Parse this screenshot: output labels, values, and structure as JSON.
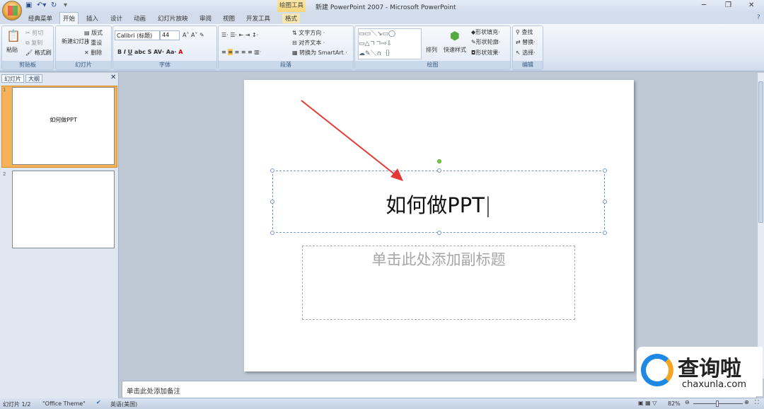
{
  "titlebar": {
    "context_tab": "绘图工具",
    "title": "新建 PowerPoint 2007 - Microsoft PowerPoint"
  },
  "tabs": [
    "经典菜单",
    "开始",
    "插入",
    "设计",
    "动画",
    "幻灯片放映",
    "审阅",
    "视图",
    "开发工具",
    "格式"
  ],
  "active_tab": "开始",
  "ribbon": {
    "clipboard": {
      "label": "剪贴板",
      "paste": "粘贴",
      "cut": "剪切",
      "copy": "复制",
      "format_painter": "格式刷"
    },
    "slides": {
      "label": "幻灯片",
      "new_slide": "新建幻灯片",
      "layout": "版式",
      "reset": "重设",
      "delete": "删除"
    },
    "font": {
      "label": "字体",
      "font_name": "Calibri (标题)",
      "font_size": "44"
    },
    "paragraph": {
      "label": "段落",
      "text_direction": "文字方向",
      "align_text": "对齐文本",
      "smartart": "转换为 SmartArt"
    },
    "drawing": {
      "label": "绘图",
      "arrange": "排列",
      "quick_styles": "快速样式",
      "shape_fill": "形状填充",
      "shape_outline": "形状轮廓",
      "shape_effects": "形状效果"
    },
    "editing": {
      "label": "编辑",
      "find": "查找",
      "replace": "替换",
      "select": "选择"
    }
  },
  "panel": {
    "tabs": [
      "幻灯片",
      "大纲"
    ],
    "thumbs": [
      {
        "num": "1",
        "text": "如何做PPT"
      },
      {
        "num": "2",
        "text": ""
      }
    ]
  },
  "slide": {
    "title": "如何做PPT",
    "subtitle_placeholder": "单击此处添加副标题"
  },
  "notes_placeholder": "单击此处添加备注",
  "status": {
    "slide": "幻灯片 1/2",
    "theme": "\"Office Theme\"",
    "language": "英语(美国)",
    "zoom": "82%"
  },
  "watermark": {
    "brand": "查询啦",
    "url": "chaxunla.com"
  },
  "colors": {
    "arrow": "#e53935",
    "selected_thumb": "#f5b25a"
  }
}
